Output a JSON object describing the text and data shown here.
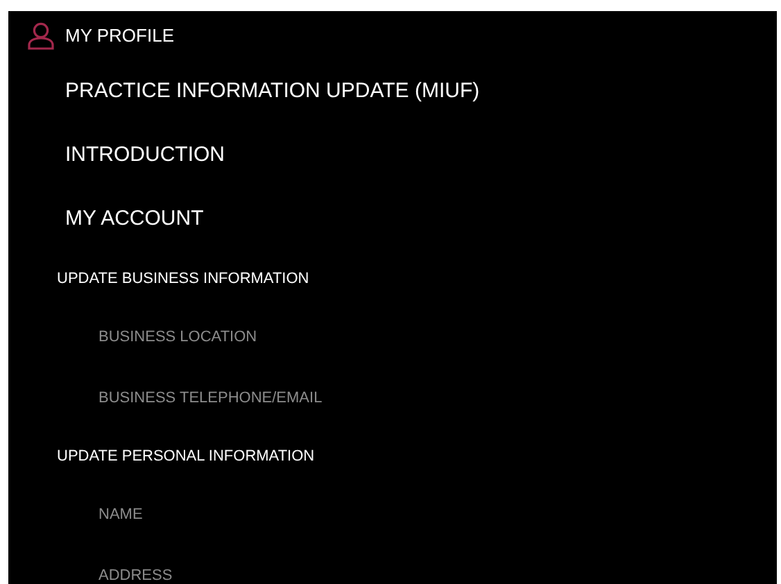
{
  "header": {
    "title": "MY PROFILE"
  },
  "menu": [
    {
      "label": "PRACTICE INFORMATION UPDATE (MIUF)"
    },
    {
      "label": "INTRODUCTION"
    },
    {
      "label": "MY ACCOUNT",
      "children": [
        {
          "label": "UPDATE BUSINESS INFORMATION",
          "children": [
            {
              "label": "BUSINESS LOCATION"
            },
            {
              "label": "BUSINESS TELEPHONE/EMAIL"
            }
          ]
        },
        {
          "label": "UPDATE PERSONAL INFORMATION",
          "children": [
            {
              "label": "NAME"
            },
            {
              "label": "ADDRESS"
            }
          ]
        }
      ]
    }
  ]
}
